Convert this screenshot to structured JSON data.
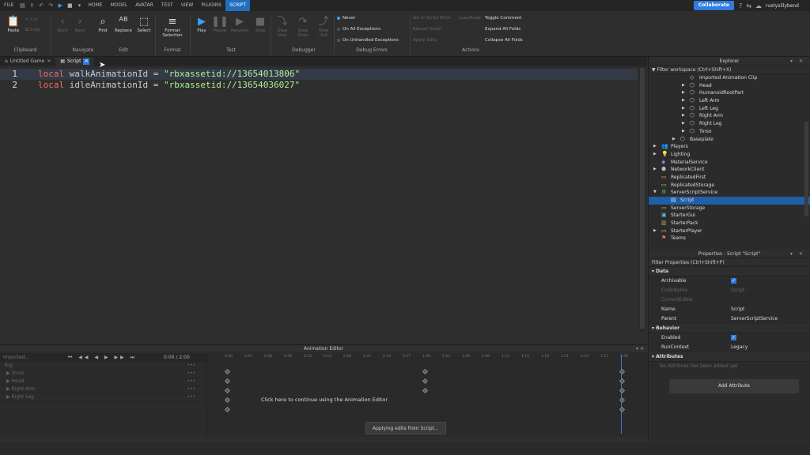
{
  "menubar": {
    "file": "FILE",
    "tabs": [
      {
        "label": "HOME",
        "active": false
      },
      {
        "label": "MODEL",
        "active": false
      },
      {
        "label": "AVATAR",
        "active": false
      },
      {
        "label": "TEST",
        "active": false
      },
      {
        "label": "VIEW",
        "active": false
      },
      {
        "label": "PLUGINS",
        "active": false
      },
      {
        "label": "SCRIPT",
        "active": true
      }
    ],
    "collaborate": "Collaborate",
    "username": "rustysillybend"
  },
  "ribbon": {
    "clipboard": {
      "paste": "Paste",
      "cut": "Cut",
      "copy": "Copy",
      "group": "Clipboard"
    },
    "navigate": {
      "back": "Back",
      "next": "Next",
      "find": "Find",
      "group": "Navigate"
    },
    "edit": {
      "replace": "Replace",
      "select": "Select",
      "group": "Edit"
    },
    "format": {
      "label1": "Format",
      "label2": "Selection",
      "group": "Format"
    },
    "test": {
      "play": "Play",
      "pause": "Pause",
      "resume": "Resume",
      "stop": "Stop",
      "group": "Test"
    },
    "debugger": {
      "step_into_1": "Step",
      "step_into_2": "Into",
      "step_over_1": "Step",
      "step_over_2": "Over",
      "step_out_1": "Step",
      "step_out_2": "Out",
      "group": "Debugger"
    },
    "debug_errors": {
      "never": "Never",
      "all": "On All Exceptions",
      "unhandled": "On Unhandled Exceptions",
      "group": "Debug Errors"
    },
    "actions": {
      "goto": "Go to Script Error",
      "reload": "Reload Script",
      "apply": "Apply Edits",
      "luau": "LuauHeap",
      "toggle": "Toggle Comment",
      "expand": "Expand All Folds",
      "collapse": "Collapse All Folds",
      "group": "Actions"
    }
  },
  "tabs": [
    {
      "label": "Untitled Game",
      "active": false
    },
    {
      "label": "Script",
      "active": true
    }
  ],
  "editor": {
    "lines": [
      {
        "num": "1",
        "kw": "local",
        "name": "walkAnimationId",
        "op": "=",
        "str": "\"rbxassetid://13654013806\""
      },
      {
        "num": "2",
        "kw": "local",
        "name": "idleAnimationId",
        "op": "=",
        "str": "\"rbxassetid://13654036027\""
      }
    ]
  },
  "animation_editor": {
    "title": "Animation Editor",
    "clip_name": "Imported...",
    "time_current": "0:00",
    "time_total": "2:00",
    "rows": [
      "Rig",
      "Torso",
      "Head",
      "Right Arm",
      "Right Leg"
    ],
    "ruler": [
      "0:00",
      "0:03",
      "0:06",
      "0:09",
      "0:12",
      "0:15",
      "0:18",
      "0:21",
      "0:24",
      "0:27",
      "1:00",
      "1:03",
      "1:06",
      "1:09",
      "1:12",
      "1:15",
      "1:18",
      "1:21",
      "1:24",
      "1:27",
      "2:00"
    ],
    "message": "Click here to continue using the Animation Editor",
    "toast": "Applying edits from Script..."
  },
  "explorer": {
    "title": "Explorer",
    "filter": "Filter workspace (Ctrl+Shift+X)",
    "items": [
      {
        "label": "Imported Animation Clip",
        "depth": 3,
        "arrow": "",
        "icon": "clip-icon",
        "selected": false
      },
      {
        "label": "Head",
        "depth": 3,
        "arrow": "▶",
        "icon": "part-icon",
        "selected": false
      },
      {
        "label": "HumanoidRootPart",
        "depth": 3,
        "arrow": "▶",
        "icon": "part-icon",
        "selected": false
      },
      {
        "label": "Left Arm",
        "depth": 3,
        "arrow": "▶",
        "icon": "part-icon",
        "selected": false
      },
      {
        "label": "Left Leg",
        "depth": 3,
        "arrow": "▶",
        "icon": "part-icon",
        "selected": false
      },
      {
        "label": "Right Arm",
        "depth": 3,
        "arrow": "▶",
        "icon": "part-icon",
        "selected": false
      },
      {
        "label": "Right Leg",
        "depth": 3,
        "arrow": "▶",
        "icon": "part-icon",
        "selected": false
      },
      {
        "label": "Torso",
        "depth": 3,
        "arrow": "▶",
        "icon": "part-icon",
        "selected": false
      },
      {
        "label": "Baseplate",
        "depth": 2,
        "arrow": "▶",
        "icon": "part-icon",
        "selected": false
      },
      {
        "label": "Players",
        "depth": 0,
        "arrow": "▶",
        "icon": "players-icon",
        "selected": false
      },
      {
        "label": "Lighting",
        "depth": 0,
        "arrow": "▶",
        "icon": "lighting-icon",
        "selected": false
      },
      {
        "label": "MaterialService",
        "depth": 0,
        "arrow": "",
        "icon": "material-icon",
        "selected": false
      },
      {
        "label": "NetworkClient",
        "depth": 0,
        "arrow": "▶",
        "icon": "network-icon",
        "selected": false
      },
      {
        "label": "ReplicatedFirst",
        "depth": 0,
        "arrow": "",
        "icon": "folder-icon",
        "selected": false
      },
      {
        "label": "ReplicatedStorage",
        "depth": 0,
        "arrow": "",
        "icon": "folder-icon",
        "selected": false
      },
      {
        "label": "ServerScriptService",
        "depth": 0,
        "arrow": "▼",
        "icon": "server-icon",
        "selected": false
      },
      {
        "label": "Script",
        "depth": 1,
        "arrow": "",
        "icon": "script-icon",
        "selected": true
      },
      {
        "label": "ServerStorage",
        "depth": 0,
        "arrow": "",
        "icon": "folder-icon",
        "selected": false
      },
      {
        "label": "StarterGui",
        "depth": 0,
        "arrow": "",
        "icon": "gui-icon",
        "selected": false
      },
      {
        "label": "StarterPack",
        "depth": 0,
        "arrow": "",
        "icon": "pack-icon",
        "selected": false
      },
      {
        "label": "StarterPlayer",
        "depth": 0,
        "arrow": "▶",
        "icon": "folder-icon",
        "selected": false
      },
      {
        "label": "Teams",
        "depth": 0,
        "arrow": "",
        "icon": "teams-icon",
        "selected": false
      }
    ]
  },
  "properties": {
    "title": "Properties - Script \"Script\"",
    "filter": "Filter Properties (Ctrl+Shift+P)",
    "data_section": "Data",
    "archivable": "Archivable",
    "codename": "CodeName",
    "codename_value": "Script",
    "current_editor": "CurrentEditor",
    "name": "Name",
    "name_value": "Script",
    "parent": "Parent",
    "parent_value": "ServerScriptService",
    "behavior_section": "Behavior",
    "enabled": "Enabled",
    "runcontext": "RunContext",
    "runcontext_value": "Legacy",
    "attributes_section": "Attributes",
    "no_attr": "No Attribute has been added yet",
    "add_attr": "Add Attribute"
  }
}
